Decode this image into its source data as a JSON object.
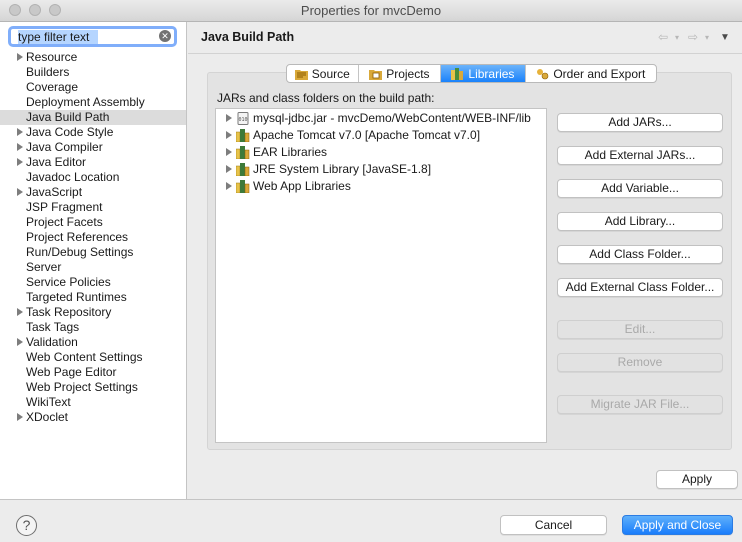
{
  "window": {
    "title": "Properties for mvcDemo"
  },
  "filter": {
    "value": "type filter text",
    "clear_icon": "clear-icon"
  },
  "sidebar": {
    "items": [
      {
        "label": "Resource",
        "expandable": true
      },
      {
        "label": "Builders",
        "expandable": false
      },
      {
        "label": "Coverage",
        "expandable": false
      },
      {
        "label": "Deployment Assembly",
        "expandable": false
      },
      {
        "label": "Java Build Path",
        "expandable": false,
        "selected": true
      },
      {
        "label": "Java Code Style",
        "expandable": true
      },
      {
        "label": "Java Compiler",
        "expandable": true
      },
      {
        "label": "Java Editor",
        "expandable": true
      },
      {
        "label": "Javadoc Location",
        "expandable": false
      },
      {
        "label": "JavaScript",
        "expandable": true
      },
      {
        "label": "JSP Fragment",
        "expandable": false
      },
      {
        "label": "Project Facets",
        "expandable": false
      },
      {
        "label": "Project References",
        "expandable": false
      },
      {
        "label": "Run/Debug Settings",
        "expandable": false
      },
      {
        "label": "Server",
        "expandable": false
      },
      {
        "label": "Service Policies",
        "expandable": false
      },
      {
        "label": "Targeted Runtimes",
        "expandable": false
      },
      {
        "label": "Task Repository",
        "expandable": true
      },
      {
        "label": "Task Tags",
        "expandable": false
      },
      {
        "label": "Validation",
        "expandable": true
      },
      {
        "label": "Web Content Settings",
        "expandable": false
      },
      {
        "label": "Web Page Editor",
        "expandable": false
      },
      {
        "label": "Web Project Settings",
        "expandable": false
      },
      {
        "label": "WikiText",
        "expandable": false
      },
      {
        "label": "XDoclet",
        "expandable": true
      }
    ]
  },
  "header": {
    "title": "Java Build Path"
  },
  "tabs": [
    {
      "label": "Source",
      "icon": "source-folder-icon",
      "active": false
    },
    {
      "label": "Projects",
      "icon": "projects-icon",
      "active": false
    },
    {
      "label": "Libraries",
      "icon": "libraries-icon",
      "active": true
    },
    {
      "label": "Order and Export",
      "icon": "order-export-icon",
      "active": false
    }
  ],
  "libraries": {
    "label": "JARs and class folders on the build path:",
    "entries": [
      {
        "label": "mysql-jdbc.jar - mvcDemo/WebContent/WEB-INF/lib",
        "icon": "jar-file-icon"
      },
      {
        "label": "Apache Tomcat v7.0 [Apache Tomcat v7.0]",
        "icon": "library-icon"
      },
      {
        "label": "EAR Libraries",
        "icon": "library-icon"
      },
      {
        "label": "JRE System Library [JavaSE-1.8]",
        "icon": "library-icon"
      },
      {
        "label": "Web App Libraries",
        "icon": "library-icon"
      }
    ]
  },
  "buttons": {
    "add_jars": "Add JARs...",
    "add_external_jars": "Add External JARs...",
    "add_variable": "Add Variable...",
    "add_library": "Add Library...",
    "add_class_folder": "Add Class Folder...",
    "add_external_class_folder": "Add External Class Folder...",
    "edit": "Edit...",
    "remove": "Remove",
    "migrate_jar_file": "Migrate JAR File...",
    "apply": "Apply",
    "cancel": "Cancel",
    "apply_and_close": "Apply and Close"
  },
  "footer": {
    "help_label": "?"
  },
  "colors": {
    "accent": "#1a82fb",
    "selection": "#b5d5ff",
    "library_icon": "#3d7a3a"
  }
}
